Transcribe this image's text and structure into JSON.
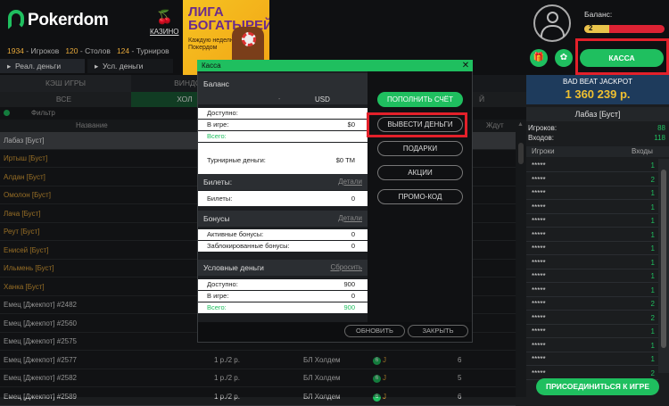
{
  "header": {
    "brand": "Pokerdom",
    "casino_label": "КАЗИНО",
    "stats": [
      {
        "value": "1934",
        "label": "Игроков"
      },
      {
        "value": "120",
        "label": "Столов"
      },
      {
        "value": "124",
        "label": "Турниров"
      }
    ],
    "tabs": [
      "Реал. деньги",
      "Усл. деньги"
    ],
    "banner": {
      "title": "ЛИГА БОГАТЫРЕЙ",
      "subtitle": "Каждую неделю на Покердом"
    },
    "balance_label": "Баланс:",
    "balance_level": "2",
    "kassa_label": "КАССА"
  },
  "lobby": {
    "categories": [
      "КЭШ ИГРЫ",
      "ВИНДС"
    ],
    "subcategories": [
      "ВСЕ",
      "ХОЛ",
      "Й"
    ],
    "filter_label": "Фильтр",
    "columns": [
      "Название",
      "Ждут"
    ],
    "selected_row": "Лабаз [Буст]",
    "rows": [
      {
        "name": "Иртыш [Буст]"
      },
      {
        "name": "Алдан [Буст]"
      },
      {
        "name": "Омолон [Буст]"
      },
      {
        "name": "Лача [Буст]"
      },
      {
        "name": "Реут [Буст]"
      },
      {
        "name": "Енисей [Буст]"
      },
      {
        "name": "Ильмень [Буст]"
      },
      {
        "name": "Ханка [Буст]"
      },
      {
        "name": "Емец [Джекпот] #2482"
      },
      {
        "name": "Емец [Джекпот] #2560"
      },
      {
        "name": "Емец [Джекпот] #2575"
      },
      {
        "name": "Емец [Джекпот] #2577",
        "stakes": "1 р./2 р.",
        "game": "БЛ Холдем",
        "players": "6"
      },
      {
        "name": "Емец [Джекпот] #2582",
        "stakes": "1 р./2 р.",
        "game": "БЛ Холдем",
        "players": "5"
      },
      {
        "name": "Емец [Джекпот] #2589",
        "stakes": "1 р./2 р.",
        "game": "БЛ Холдем",
        "players": "6"
      }
    ]
  },
  "right_panel": {
    "jackpot_label": "BAD BEAT JACKPOT",
    "jackpot_value": "1 360 239 р.",
    "table_title": "Лабаз [Буст]",
    "players_label": "Игроков:",
    "players_value": "88",
    "entries_label": "Входов:",
    "entries_value": "118",
    "col_players": "Игроки",
    "col_entries": "Входы",
    "rows": [
      {
        "name": "*****",
        "v": "1"
      },
      {
        "name": "*****",
        "v": "2"
      },
      {
        "name": "*****",
        "v": "1"
      },
      {
        "name": "*****",
        "v": "1"
      },
      {
        "name": "*****",
        "v": "1"
      },
      {
        "name": "*****",
        "v": "1"
      },
      {
        "name": "*****",
        "v": "1"
      },
      {
        "name": "*****",
        "v": "1"
      },
      {
        "name": "*****",
        "v": "1"
      },
      {
        "name": "*****",
        "v": "1"
      },
      {
        "name": "*****",
        "v": "2"
      },
      {
        "name": "*****",
        "v": "2"
      },
      {
        "name": "*****",
        "v": "1"
      },
      {
        "name": "*****",
        "v": "1"
      },
      {
        "name": "*****",
        "v": "1"
      },
      {
        "name": "*****",
        "v": "2"
      }
    ],
    "join_label": "ПРИСОЕДИНИТЬСЯ К ИГРЕ"
  },
  "modal": {
    "title": "Касса",
    "balance_section": "Баланс",
    "currency": "USD",
    "available_label": "Доступно:",
    "in_game_label": "В игре:",
    "in_game_value": "$0",
    "total_label": "Всего:",
    "tourney_label": "Турнирные деньги:",
    "tourney_value": "$0 ТМ",
    "tickets_section": "Билеты:",
    "tickets_details": "Детали",
    "tickets_label": "Билеты:",
    "tickets_value": "0",
    "bonus_section": "Бонусы",
    "bonus_details": "Детали",
    "active_bonus_label": "Активные бонусы:",
    "active_bonus_value": "0",
    "locked_bonus_label": "Заблокированные бонусы:",
    "locked_bonus_value": "0",
    "cond_section": "Условные деньги",
    "cond_reset": "Сбросить",
    "cond_available_label": "Доступно:",
    "cond_available_value": "900",
    "cond_in_game_label": "В игре:",
    "cond_in_game_value": "0",
    "cond_total_label": "Всего:",
    "cond_total_value": "900",
    "buttons": {
      "deposit": "ПОПОЛНИТЬ СЧЁТ",
      "withdraw": "ВЫВЕСТИ ДЕНЬГИ",
      "gifts": "ПОДАРКИ",
      "promos": "АКЦИИ",
      "promo_code": "ПРОМО-КОД"
    },
    "refresh": "ОБНОВИТЬ",
    "close": "ЗАКРЫТЬ"
  },
  "colors": {
    "accent": "#1fbf5f",
    "highlight": "#e3202a",
    "orange_text": "#e7a83a"
  }
}
